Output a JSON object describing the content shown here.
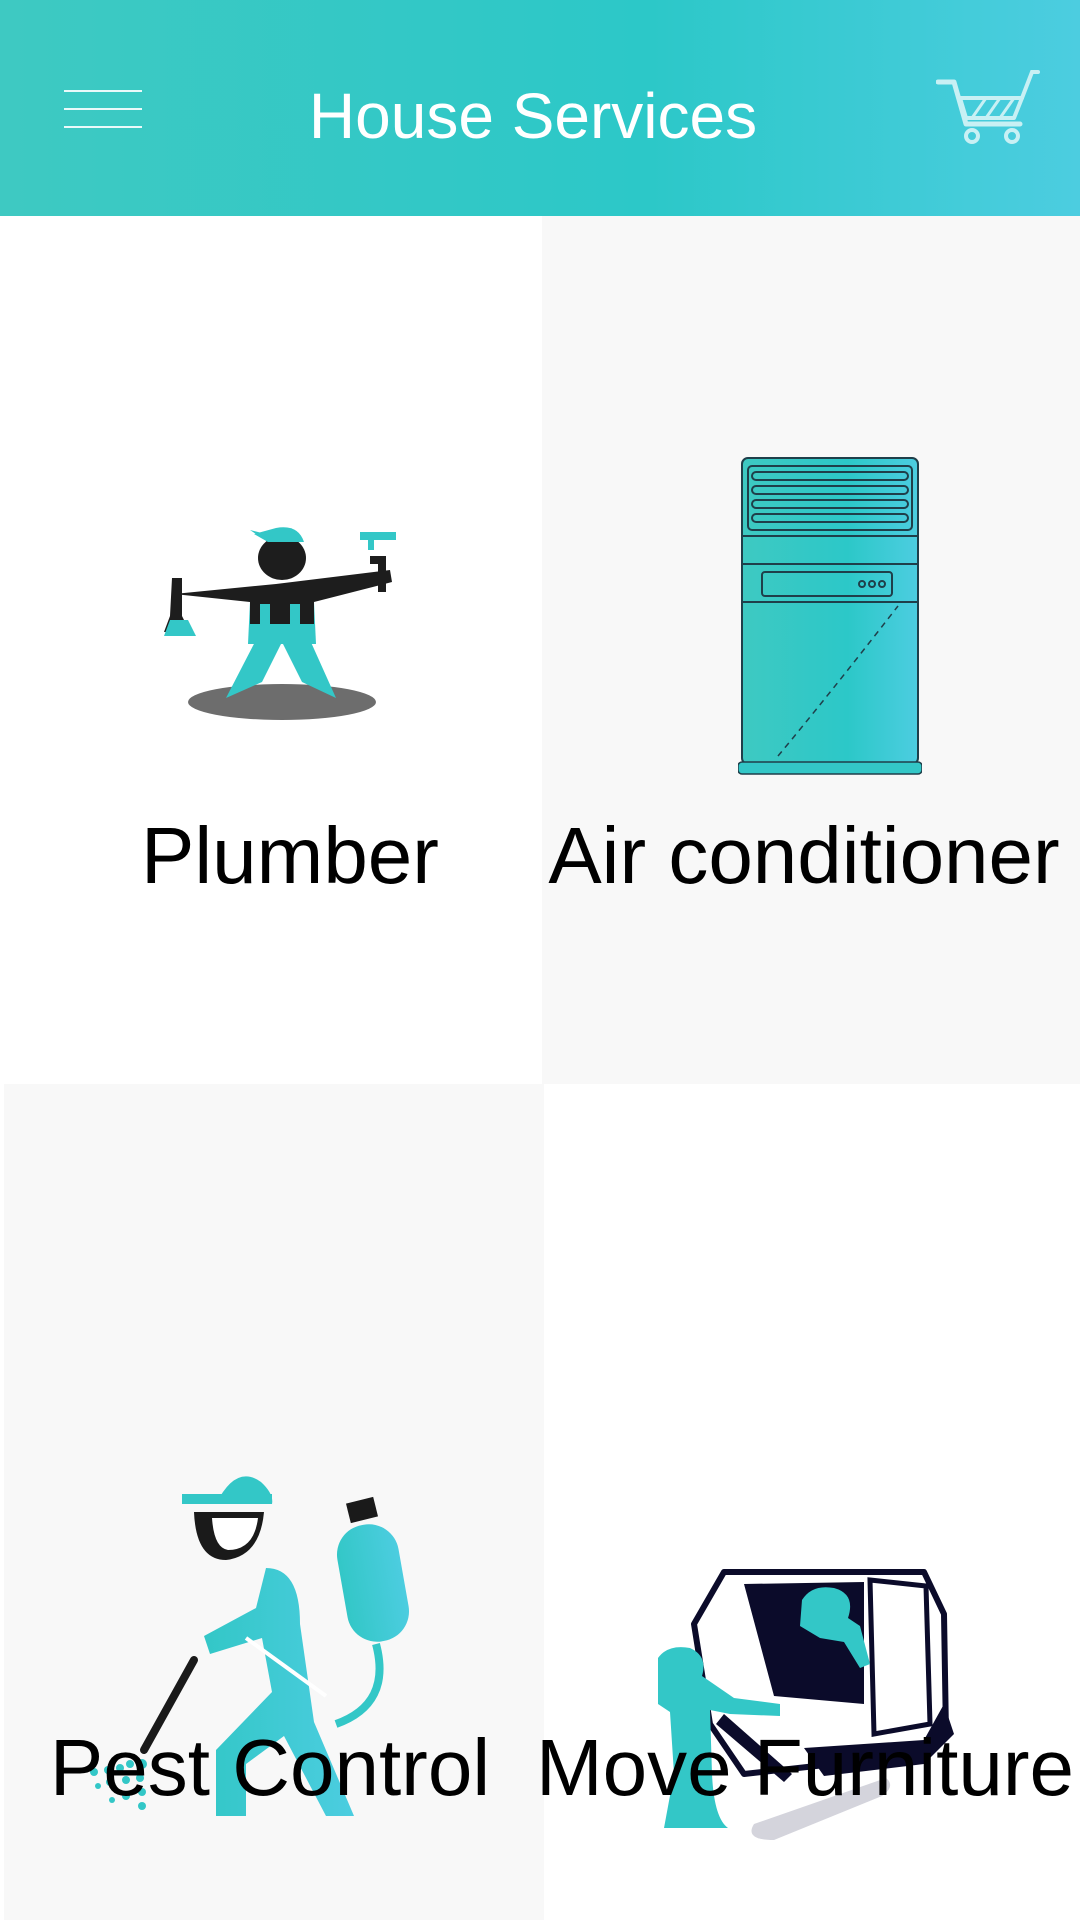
{
  "app_bar": {
    "title": "House Services",
    "menu_icon": "hamburger-menu-icon",
    "cart_icon": "shopping-cart-icon"
  },
  "services": [
    {
      "label": "Plumber",
      "icon": "plumber-icon"
    },
    {
      "label": "Air conditioner",
      "icon": "air-conditioner-icon"
    },
    {
      "label": "Pest Control",
      "icon": "pest-control-icon"
    },
    {
      "label": "Move Furniture",
      "icon": "move-furniture-icon"
    }
  ],
  "colors": {
    "accent": "#2cc8c8",
    "accent_light": "#4ccde0",
    "dark": "#1a1a1a",
    "navy": "#0b0b2a",
    "shadow": "#6d6d6d"
  }
}
